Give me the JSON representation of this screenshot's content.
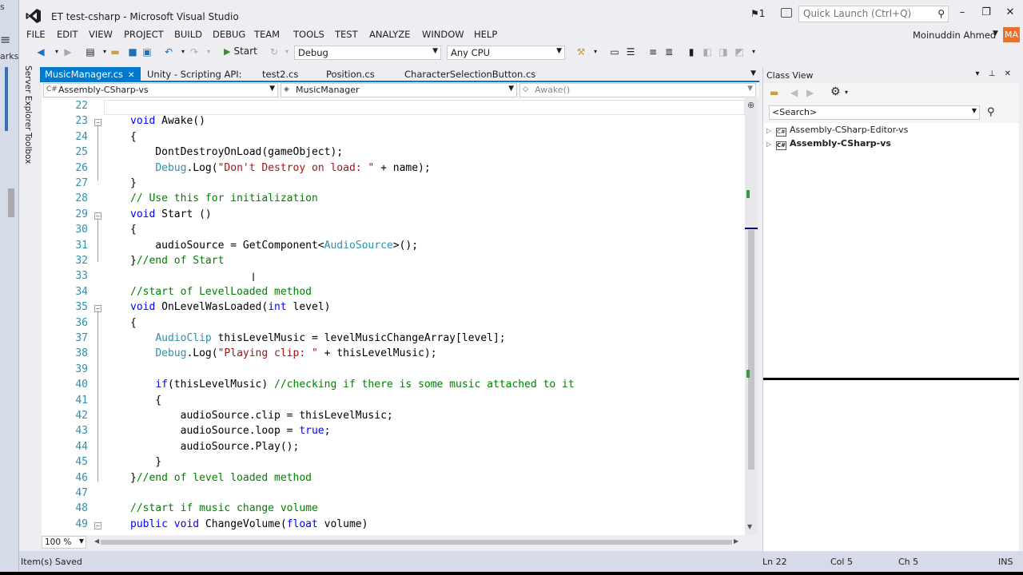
{
  "window": {
    "title": "ET test-csharp - Microsoft Visual Studio",
    "notification_count": "1",
    "quick_launch_placeholder": "Quick Launch (Ctrl+Q)",
    "controls": [
      "–",
      "❐",
      "✕"
    ]
  },
  "background_fragments": [
    "s",
    "arks"
  ],
  "menu": {
    "items": [
      "FILE",
      "EDIT",
      "VIEW",
      "PROJECT",
      "BUILD",
      "DEBUG",
      "TEAM",
      "TOOLS",
      "TEST",
      "ANALYZE",
      "WINDOW",
      "HELP"
    ],
    "user_name": "Moinuddin Ahmed",
    "user_initials": "MA"
  },
  "toolbar": {
    "start_label": "Start",
    "configuration": "Debug",
    "platform": "Any CPU"
  },
  "side_tabs": [
    "Server Explorer",
    "Toolbox"
  ],
  "doc_tabs": [
    {
      "label": "MusicManager.cs",
      "active": true
    },
    {
      "label": "Unity - Scripting API:",
      "active": false
    },
    {
      "label": "test2.cs",
      "active": false
    },
    {
      "label": "Position.cs",
      "active": false
    },
    {
      "label": "CharacterSelectionButton.cs",
      "active": false
    }
  ],
  "nav": {
    "project": "Assembly-CSharp-vs",
    "class": "MusicManager",
    "member": "Awake()"
  },
  "code_lines": [
    {
      "n": "22",
      "html": ""
    },
    {
      "n": "23",
      "html": "<span class=\"kw\">void</span> Awake()"
    },
    {
      "n": "24",
      "html": "{"
    },
    {
      "n": "25",
      "html": "    DontDestroyOnLoad(gameObject);"
    },
    {
      "n": "26",
      "html": "    <span class=\"ty\">Debug</span>.Log(<span class=\"str\">\"Don't Destroy on load: \"</span> + name);"
    },
    {
      "n": "27",
      "html": "}"
    },
    {
      "n": "28",
      "html": "<span class=\"cm\">// Use this for initialization</span>"
    },
    {
      "n": "29",
      "html": "<span class=\"kw\">void</span> Start ()"
    },
    {
      "n": "30",
      "html": "{"
    },
    {
      "n": "31",
      "html": "    audioSource = GetComponent&lt;<span class=\"ty\">AudioSource</span>&gt;();"
    },
    {
      "n": "32",
      "html": "}<span class=\"cm\">//end of Start</span>"
    },
    {
      "n": "33",
      "html": ""
    },
    {
      "n": "34",
      "html": "<span class=\"cm\">//start of LevelLoaded method</span>"
    },
    {
      "n": "35",
      "html": "<span class=\"kw\">void</span> OnLevelWasLoaded(<span class=\"kw\">int</span> level)"
    },
    {
      "n": "36",
      "html": "{"
    },
    {
      "n": "37",
      "html": "    <span class=\"ty\">AudioClip</span> thisLevelMusic = levelMusicChangeArray[level];"
    },
    {
      "n": "38",
      "html": "    <span class=\"ty\">Debug</span>.Log(<span class=\"str\">\"Playing clip: \"</span> + thisLevelMusic);"
    },
    {
      "n": "39",
      "html": ""
    },
    {
      "n": "40",
      "html": "    <span class=\"kw\">if</span>(thisLevelMusic) <span class=\"cm\">//checking if there is some music attached to it</span>"
    },
    {
      "n": "41",
      "html": "    {"
    },
    {
      "n": "42",
      "html": "        audioSource.clip = thisLevelMusic;"
    },
    {
      "n": "43",
      "html": "        audioSource.loop = <span class=\"kw\">true</span>;"
    },
    {
      "n": "44",
      "html": "        audioSource.Play();"
    },
    {
      "n": "45",
      "html": "    }"
    },
    {
      "n": "46",
      "html": "}<span class=\"cm\">//end of level loaded method</span>"
    },
    {
      "n": "47",
      "html": ""
    },
    {
      "n": "48",
      "html": "<span class=\"cm\">//start if music change volume</span>"
    },
    {
      "n": "49",
      "html": "<span class=\"kw\">public</span> <span class=\"kw\">void</span> ChangeVolume(<span class=\"kw\">float</span> volume)"
    }
  ],
  "editor": {
    "zoom": "100 %"
  },
  "class_view": {
    "title": "Class View",
    "search_placeholder": "<Search>",
    "nodes": [
      {
        "label": "Assembly-CSharp-Editor-vs",
        "bold": false
      },
      {
        "label": "Assembly-CSharp-vs",
        "bold": true
      }
    ]
  },
  "status": {
    "message": "Item(s) Saved",
    "line": "Ln 22",
    "col": "Col 5",
    "ch": "Ch 5",
    "mode": "INS"
  },
  "colors": {
    "accent": "#007acc",
    "keyword": "#0000ff",
    "type": "#2b91af",
    "string": "#a31515",
    "comment": "#008000"
  }
}
